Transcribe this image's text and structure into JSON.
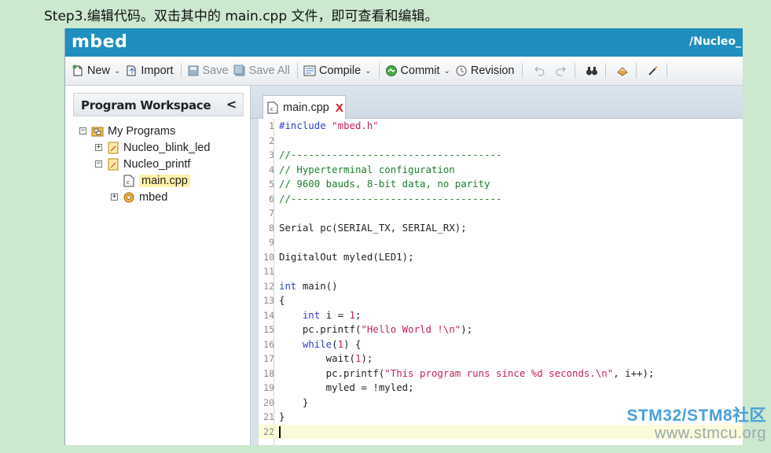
{
  "caption": "Step3.编辑代码。双击其中的 main.cpp 文件，即可查看和编辑。",
  "app": {
    "logo": "mbed",
    "path": "/Nucleo_"
  },
  "toolbar": {
    "new": "New",
    "import": "Import",
    "save": "Save",
    "save_all": "Save All",
    "compile": "Compile",
    "commit": "Commit",
    "revision": "Revision"
  },
  "workspace": {
    "title": "Program Workspace",
    "collapse": "<",
    "root": "My Programs",
    "programs": [
      "Nucleo_blink_led",
      "Nucleo_printf"
    ],
    "file": "main.cpp",
    "library": "mbed"
  },
  "editor": {
    "tab": "main.cpp",
    "tab_close": "X",
    "lines": [
      "#include \"mbed.h\"",
      "",
      "//------------------------------------",
      "// Hyperterminal configuration",
      "// 9600 bauds, 8-bit data, no parity",
      "//------------------------------------",
      "",
      "Serial pc(SERIAL_TX, SERIAL_RX);",
      "",
      "DigitalOut myled(LED1);",
      "",
      "int main()",
      "{",
      "    int i = 1;",
      "    pc.printf(\"Hello World !\\n\");",
      "    while(1) {",
      "        wait(1);",
      "        pc.printf(\"This program runs since %d seconds.\\n\", i++);",
      "        myled = !myled;",
      "    }",
      "}",
      ""
    ],
    "current_line": 22
  },
  "watermark": {
    "brand": "STM32/STM8社区",
    "site": "www.stmcu.org"
  }
}
